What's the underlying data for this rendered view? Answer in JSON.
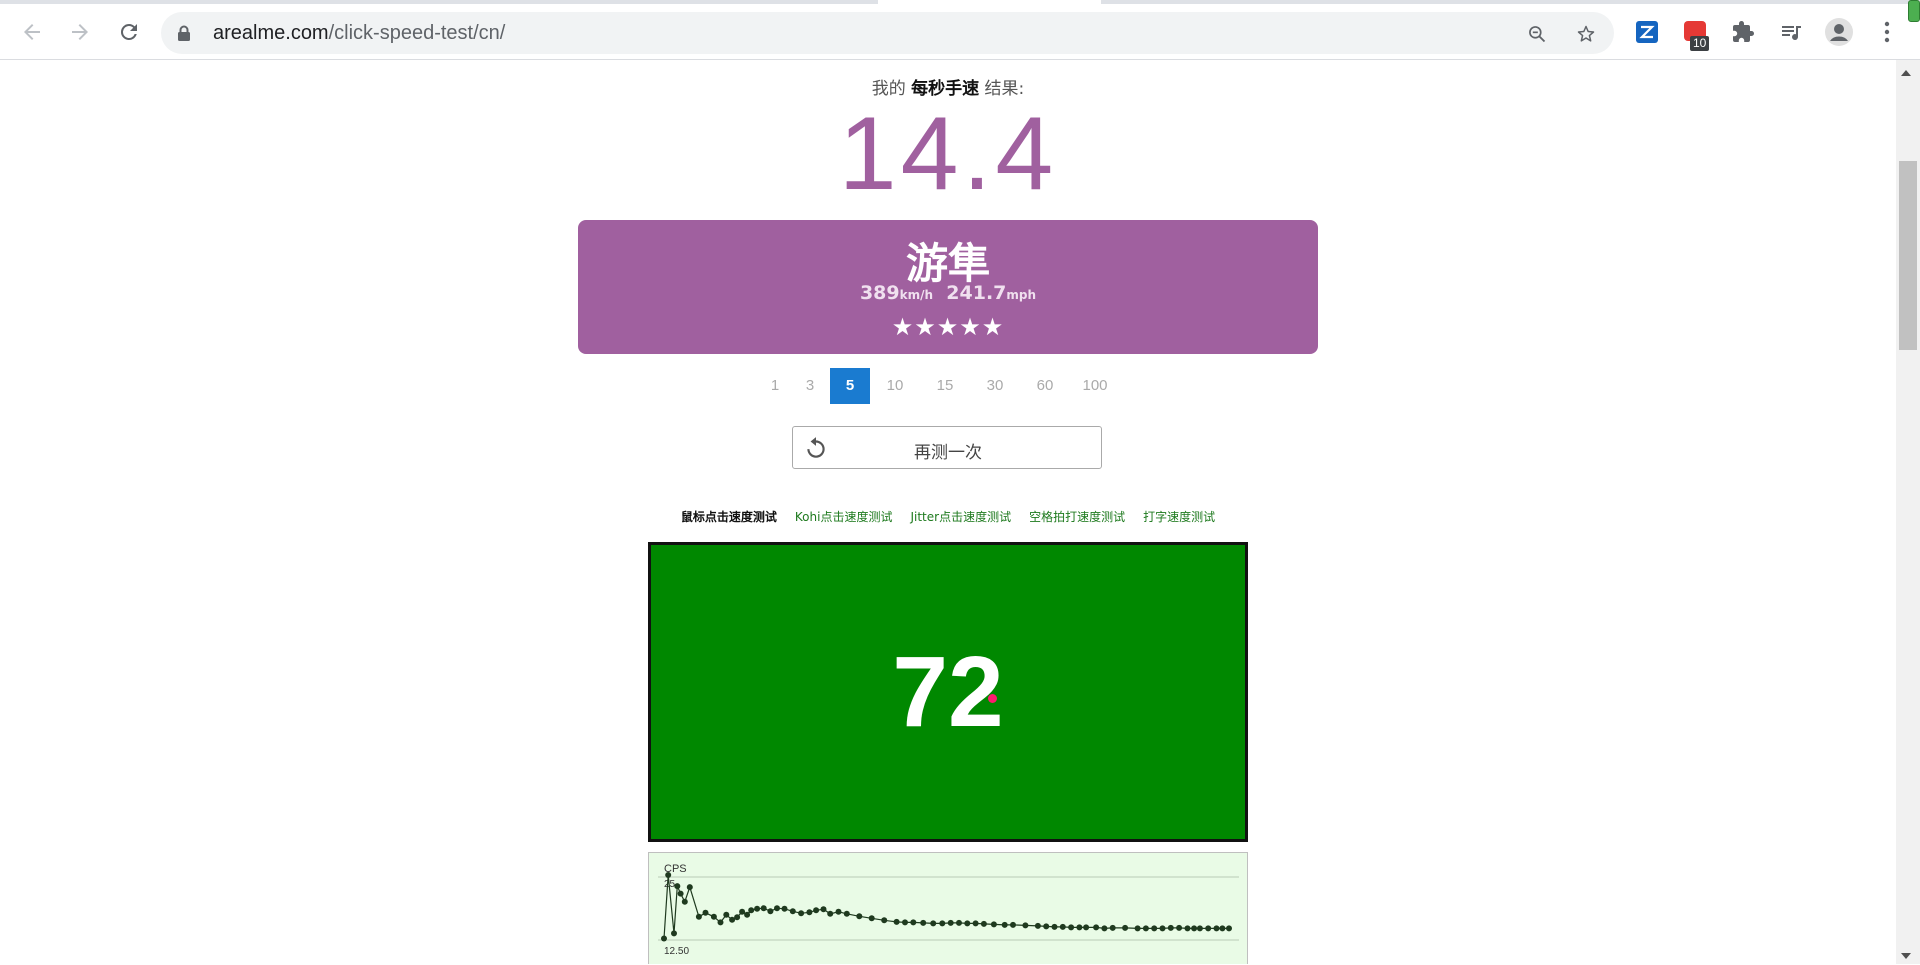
{
  "browser": {
    "url_host": "arealme.com",
    "url_path": "/click-speed-test/cn/",
    "extension_badge": "10"
  },
  "result": {
    "prefix": "我的",
    "metric": "每秒手速",
    "suffix": "结果:",
    "cps": "14.4"
  },
  "rank_card": {
    "title": "游隼",
    "speed_kmh": "389",
    "unit_kmh": "km/h",
    "speed_mph": "241.7",
    "unit_mph": "mph",
    "stars": "★★★★★",
    "star_rating": 5
  },
  "time_options": {
    "items": [
      "1",
      "3",
      "5",
      "10",
      "15",
      "30",
      "60",
      "100"
    ],
    "selected": "5"
  },
  "retry_button": {
    "label": "再测一次"
  },
  "test_links": {
    "items": [
      "鼠标点击速度测试",
      "Kohi点击速度测试",
      "Jitter点击速度测试",
      "空格拍打速度测试",
      "打字速度测试"
    ],
    "current": "鼠标点击速度测试"
  },
  "click_area": {
    "count": "72",
    "background": "#008800",
    "pointer_color": "#ff1a6e"
  },
  "colors": {
    "accent_purple": "#a0609f",
    "tab_active_blue": "#1a7bd0",
    "link_green": "#1e7a1e",
    "chart_bg": "#e9fbe6"
  },
  "chart_data": {
    "type": "line",
    "ylabel": "CPS",
    "y_tick_labels": [
      "25",
      "12.50"
    ],
    "ylim": [
      12.5,
      25
    ],
    "points": [
      [
        0.0,
        12.8
      ],
      [
        0.05,
        25.4
      ],
      [
        0.12,
        13.8
      ],
      [
        0.16,
        23.2
      ],
      [
        0.2,
        21.7
      ],
      [
        0.25,
        20.1
      ],
      [
        0.31,
        23.0
      ],
      [
        0.42,
        17.1
      ],
      [
        0.5,
        17.9
      ],
      [
        0.6,
        17.1
      ],
      [
        0.68,
        16.0
      ],
      [
        0.75,
        17.5
      ],
      [
        0.82,
        16.5
      ],
      [
        0.88,
        17.0
      ],
      [
        0.94,
        18.1
      ],
      [
        1.0,
        17.5
      ],
      [
        1.05,
        18.4
      ],
      [
        1.12,
        18.7
      ],
      [
        1.2,
        18.8
      ],
      [
        1.28,
        18.2
      ],
      [
        1.36,
        18.8
      ],
      [
        1.45,
        18.7
      ],
      [
        1.55,
        18.2
      ],
      [
        1.65,
        17.8
      ],
      [
        1.75,
        18.0
      ],
      [
        1.83,
        18.4
      ],
      [
        1.92,
        18.6
      ],
      [
        2.0,
        17.7
      ],
      [
        2.1,
        18.1
      ],
      [
        2.2,
        17.7
      ],
      [
        2.35,
        17.2
      ],
      [
        2.5,
        16.8
      ],
      [
        2.65,
        16.4
      ],
      [
        2.8,
        16.1
      ],
      [
        2.9,
        16.0
      ],
      [
        3.0,
        16.0
      ],
      [
        3.12,
        15.9
      ],
      [
        3.24,
        15.8
      ],
      [
        3.35,
        15.8
      ],
      [
        3.45,
        15.9
      ],
      [
        3.55,
        15.9
      ],
      [
        3.65,
        15.8
      ],
      [
        3.75,
        15.8
      ],
      [
        3.85,
        15.7
      ],
      [
        3.97,
        15.6
      ],
      [
        4.1,
        15.5
      ],
      [
        4.2,
        15.5
      ],
      [
        4.35,
        15.4
      ],
      [
        4.5,
        15.3
      ],
      [
        4.6,
        15.2
      ],
      [
        4.7,
        15.1
      ],
      [
        4.8,
        15.1
      ],
      [
        4.9,
        15.0
      ],
      [
        5.0,
        15.0
      ],
      [
        5.08,
        15.0
      ],
      [
        5.2,
        15.0
      ],
      [
        5.3,
        14.8
      ],
      [
        5.4,
        14.9
      ],
      [
        5.55,
        14.9
      ],
      [
        5.7,
        14.8
      ],
      [
        5.8,
        14.8
      ],
      [
        5.9,
        14.8
      ],
      [
        6.0,
        14.8
      ],
      [
        6.1,
        14.9
      ],
      [
        6.2,
        14.9
      ],
      [
        6.3,
        14.8
      ],
      [
        6.38,
        14.8
      ],
      [
        6.45,
        14.8
      ],
      [
        6.55,
        14.8
      ],
      [
        6.65,
        14.8
      ],
      [
        6.72,
        14.8
      ],
      [
        6.8,
        14.8
      ]
    ]
  }
}
